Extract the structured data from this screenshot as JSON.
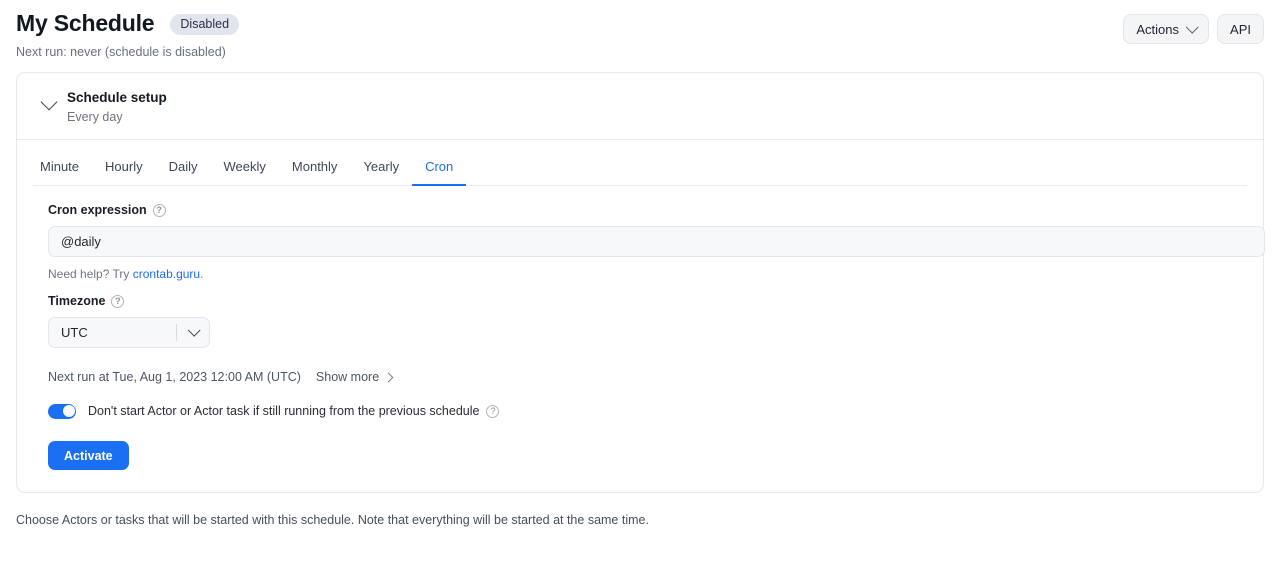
{
  "header": {
    "title": "My Schedule",
    "status_badge": "Disabled",
    "subtitle": "Next run: never (schedule is disabled)",
    "actions_button": "Actions",
    "api_button": "API",
    "chevron_icon": "chevron-down-icon"
  },
  "card": {
    "head": {
      "title": "Schedule setup",
      "subtitle": "Every day",
      "collapse_icon": "chevron-down-icon"
    },
    "tabs": [
      {
        "label": "Minute",
        "active": false
      },
      {
        "label": "Hourly",
        "active": false
      },
      {
        "label": "Daily",
        "active": false
      },
      {
        "label": "Weekly",
        "active": false
      },
      {
        "label": "Monthly",
        "active": false
      },
      {
        "label": "Yearly",
        "active": false
      },
      {
        "label": "Cron",
        "active": true
      }
    ],
    "form": {
      "cron_label": "Cron expression",
      "cron_help_icon": "help-circle-icon",
      "cron_value": "@daily",
      "cron_placeholder": "@daily",
      "hint_prefix": "Need help? Try ",
      "hint_link": "crontab.guru",
      "hint_suffix": ".",
      "timezone_label": "Timezone",
      "timezone_help_icon": "help-circle-icon",
      "timezone_value": "UTC",
      "timezone_options": [
        "UTC"
      ],
      "timezone_chevron_icon": "chevron-down-icon",
      "next_run_text": "Next run at Tue, Aug 1, 2023 12:00 AM (UTC)",
      "show_more_label": "Show more",
      "show_more_icon": "chevron-right-icon",
      "toggle_on": true,
      "toggle_label": "Don't start Actor or Actor task if still running from the previous schedule",
      "toggle_help_icon": "help-circle-icon",
      "activate_button": "Activate"
    }
  },
  "footer": {
    "note": "Choose Actors or tasks that will be started with this schedule. Note that everything will be started at the same time."
  },
  "colors": {
    "accent": "#1b6ff3",
    "badge_bg": "#e2e4ee",
    "card_border": "#e7e9ed",
    "input_bg": "#f7f8fa",
    "muted_text": "#69717d"
  }
}
